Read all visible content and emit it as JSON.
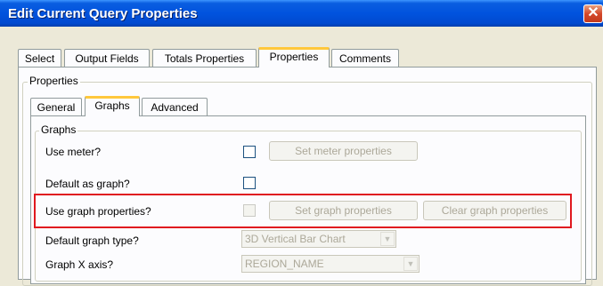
{
  "window": {
    "title": "Edit Current Query Properties",
    "close_label": "✕"
  },
  "top_tabs": [
    {
      "label": "Select",
      "active": false
    },
    {
      "label": "Output Fields",
      "active": false
    },
    {
      "label": "Totals Properties",
      "active": false
    },
    {
      "label": "Properties",
      "active": true
    },
    {
      "label": "Comments",
      "active": false
    }
  ],
  "properties_group": {
    "label": "Properties"
  },
  "sub_tabs": [
    {
      "label": "General",
      "active": false
    },
    {
      "label": "Graphs",
      "active": true
    },
    {
      "label": "Advanced",
      "active": false
    }
  ],
  "graphs_group": {
    "label": "Graphs",
    "rows": [
      {
        "label": "Use meter?",
        "checked": false,
        "enabled": true,
        "button": "Set meter properties"
      },
      {
        "label": "Default as graph?",
        "checked": false,
        "enabled": true
      },
      {
        "label": "Use graph properties?",
        "checked": false,
        "enabled": false,
        "button": "Set graph properties",
        "button2": "Clear graph properties"
      },
      {
        "label": "Default graph type?",
        "select": "3D Vertical Bar Chart"
      },
      {
        "label": "Graph X axis?",
        "select": "REGION_NAME"
      }
    ]
  },
  "colors": {
    "highlight": "#E0191F",
    "titlebar": "#0153DE",
    "tab_accent": "#FFC83C"
  }
}
